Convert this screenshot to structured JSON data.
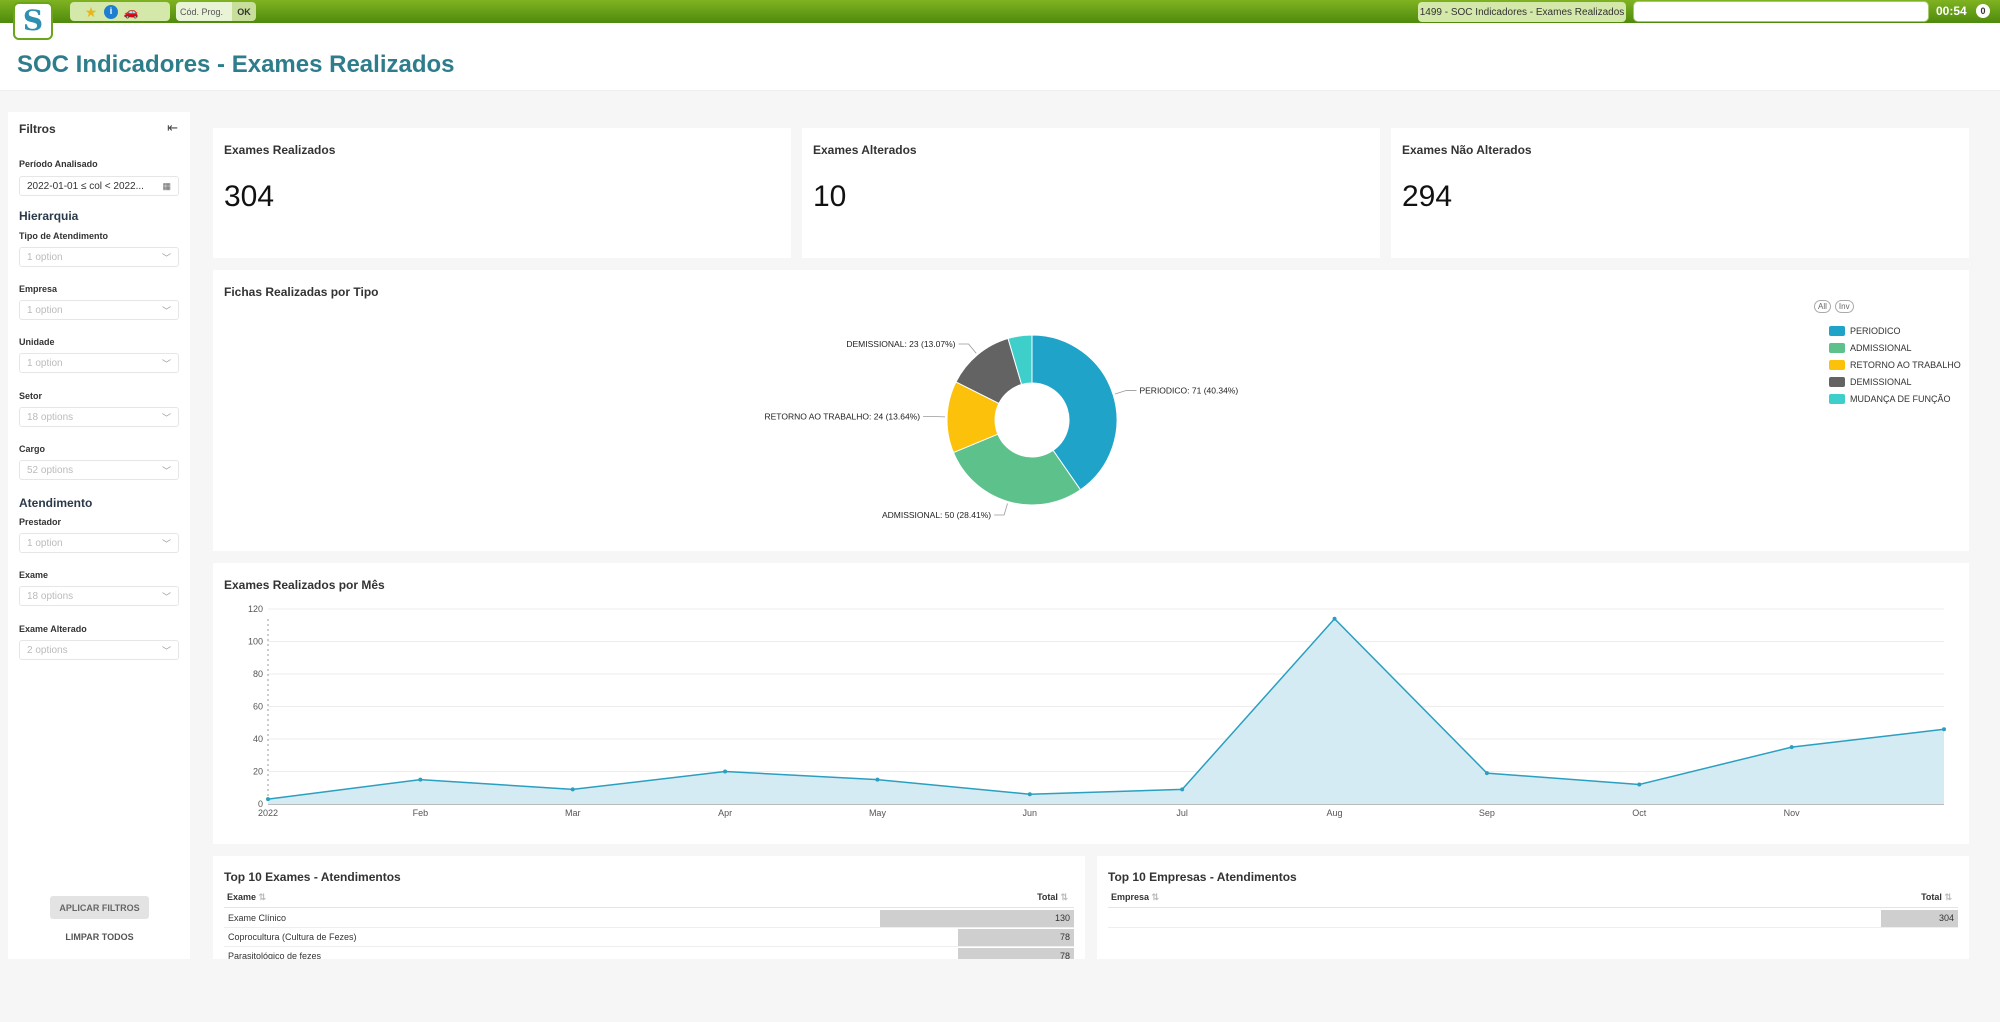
{
  "topbar": {
    "cod_prog_label": "Cód. Prog.",
    "ok_label": "OK",
    "screen_title": "1499 - SOC Indicadores - Exames Realizados",
    "time": "00:54",
    "notification_count": "0",
    "icons": [
      "favorites-star-icon",
      "info-icon",
      "car-icon"
    ]
  },
  "page": {
    "title": "SOC Indicadores - Exames Realizados"
  },
  "filters": {
    "title": "Filtros",
    "period_label": "Período Analisado",
    "period_value": "2022-01-01 ≤ col < 2022...",
    "hierarchy_title": "Hierarquia",
    "tipo_label": "Tipo de Atendimento",
    "tipo_value": "1 option",
    "empresa_label": "Empresa",
    "empresa_value": "1 option",
    "unidade_label": "Unidade",
    "unidade_value": "1 option",
    "setor_label": "Setor",
    "setor_value": "18 options",
    "cargo_label": "Cargo",
    "cargo_value": "52 options",
    "atendimento_title": "Atendimento",
    "prestador_label": "Prestador",
    "prestador_value": "1 option",
    "exame_label": "Exame",
    "exame_value": "18 options",
    "exame_alterado_label": "Exame Alterado",
    "exame_alterado_value": "2 options",
    "apply_label": "APLICAR FILTROS",
    "clear_label": "LIMPAR TODOS"
  },
  "kpis": {
    "realizados": {
      "title": "Exames Realizados",
      "value": "304"
    },
    "alterados": {
      "title": "Exames Alterados",
      "value": "10"
    },
    "nao_alterados": {
      "title": "Exames Não Alterados",
      "value": "294"
    }
  },
  "pie_card": {
    "title": "Fichas Realizadas por Tipo",
    "all_label": "All",
    "inv_label": "Inv"
  },
  "line_card": {
    "title": "Exames Realizados por Mês"
  },
  "top_exames": {
    "title": "Top 10 Exames - Atendimentos",
    "col_name": "Exame",
    "col_total": "Total",
    "rows": [
      {
        "name": "Exame Clínico",
        "total": 130
      },
      {
        "name": "Coprocultura (Cultura de Fezes)",
        "total": 78
      },
      {
        "name": "Parasitológico de fezes",
        "total": 78
      }
    ]
  },
  "top_empresas": {
    "title": "Top 10 Empresas - Atendimentos",
    "col_name": "Empresa",
    "col_total": "Total",
    "rows": [
      {
        "name": "",
        "total": 304
      }
    ]
  },
  "chart_data": [
    {
      "type": "pie",
      "donut": true,
      "title": "Fichas Realizadas por Tipo",
      "legend_position": "top-right",
      "slices": [
        {
          "label": "PERIODICO",
          "value": 71,
          "display": "PERIODICO: 71 (40.34%)",
          "color": "#1fa3c9"
        },
        {
          "label": "ADMISSIONAL",
          "value": 50,
          "display": "ADMISSIONAL: 50 (28.41%)",
          "color": "#5cc18a"
        },
        {
          "label": "RETORNO AO TRABALHO",
          "value": 24,
          "display": "RETORNO AO TRABALHO: 24 (13.64%)",
          "color": "#fcc20b"
        },
        {
          "label": "DEMISSIONAL",
          "value": 23,
          "display": "DEMISSIONAL: 23 (13.07%)",
          "color": "#636363"
        },
        {
          "label": "MUDANÇA DE FUNÇÃO",
          "value": 8,
          "display": "",
          "color": "#3fcfcb"
        }
      ]
    },
    {
      "type": "area",
      "title": "Exames Realizados por Mês",
      "x": [
        "2022-01",
        "2022-02",
        "2022-03",
        "2022-04",
        "2022-05",
        "2022-06",
        "2022-07",
        "2022-08",
        "2022-09",
        "2022-10",
        "2022-11",
        "2022-12"
      ],
      "x_tick_labels": [
        "2022",
        "Feb",
        "Mar",
        "Apr",
        "May",
        "Jun",
        "Jul",
        "Aug",
        "Sep",
        "Oct",
        "Nov"
      ],
      "values": [
        3,
        15,
        9,
        20,
        15,
        6,
        9,
        114,
        19,
        12,
        35,
        46
      ],
      "y_ticks": [
        0,
        20,
        40,
        60,
        80,
        100,
        120
      ],
      "ylim": [
        0,
        120
      ],
      "grid": true,
      "color": "#2b9fc0"
    }
  ]
}
